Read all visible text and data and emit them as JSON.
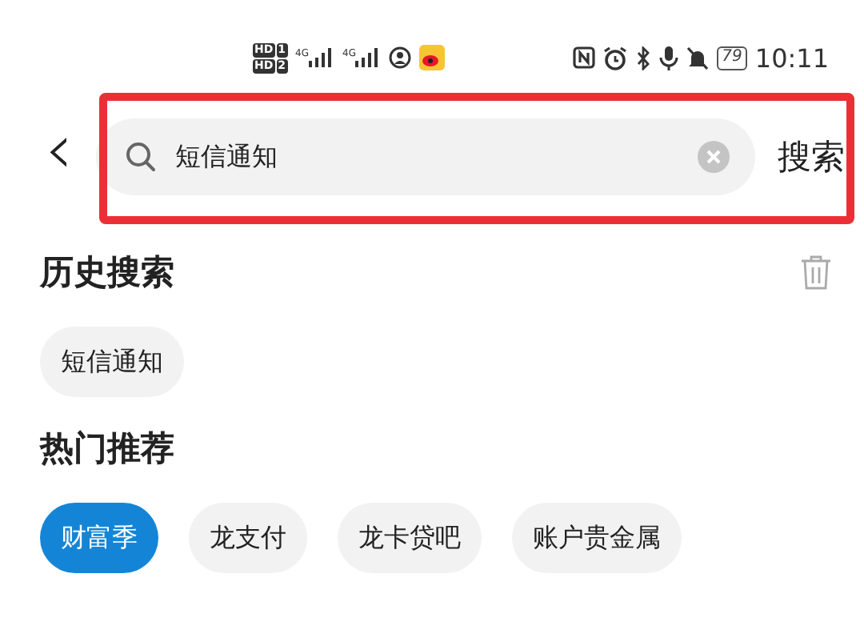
{
  "status_bar": {
    "sims": [
      {
        "badge": "HD",
        "slot": "1"
      },
      {
        "badge": "HD",
        "slot": "2"
      }
    ],
    "signals": [
      {
        "network": "4G"
      },
      {
        "network": "4G"
      }
    ],
    "battery": "79",
    "time": "10:11"
  },
  "search_bar": {
    "back": "‹",
    "query": "短信通知",
    "highlighted": true,
    "action": "搜索"
  },
  "history": {
    "title": "历史搜索",
    "items": [
      "短信通知"
    ]
  },
  "hot": {
    "title": "热门推荐",
    "items": [
      {
        "label": "财富季",
        "selected": true
      },
      {
        "label": "龙支付",
        "selected": false
      },
      {
        "label": "龙卡贷吧",
        "selected": false
      },
      {
        "label": "账户贵金属",
        "selected": false
      }
    ]
  }
}
